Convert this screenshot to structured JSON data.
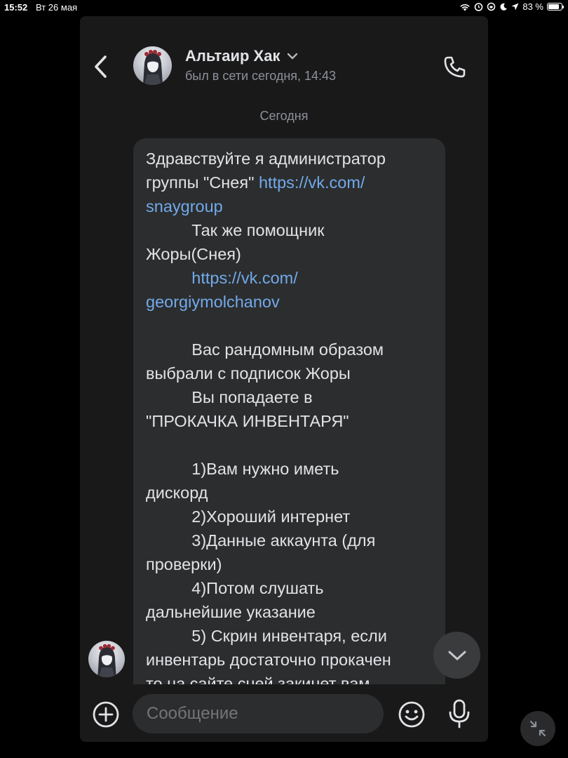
{
  "status_bar": {
    "time": "15:52",
    "date": "Вт 26 мая",
    "battery_percent": "83 %",
    "battery_level": 0.83
  },
  "chat": {
    "contact_name": "Альтаир Хак",
    "contact_status": "был в сети сегодня, 14:43",
    "date_separator": "Сегодня",
    "message_lines": [
      {
        "text": "Здравствуйте я администратор",
        "link": false
      },
      {
        "text": "группы \"Снея\" ",
        "link_text": "https://vk.com/",
        "link": true
      },
      {
        "text": "snaygroup",
        "link": true,
        "full_link": true
      },
      {
        "text": "          Так же помощник",
        "link": false
      },
      {
        "text": "Жоры(Снея)",
        "link": false
      },
      {
        "text": "          https://vk.com/",
        "link": true,
        "full_link": true
      },
      {
        "text": "georgiymolchanov",
        "link": true,
        "full_link": true
      },
      {
        "text": "",
        "link": false
      },
      {
        "text": "          Вас рандомным образом",
        "link": false
      },
      {
        "text": "выбрали с подписок Жоры",
        "link": false
      },
      {
        "text": "          Вы попадаете в",
        "link": false
      },
      {
        "text": "\"ПРОКАЧКА ИНВЕНТАРЯ\"",
        "link": false
      },
      {
        "text": "",
        "link": false
      },
      {
        "text": "          1)Вам нужно иметь",
        "link": false
      },
      {
        "text": "дискорд",
        "link": false
      },
      {
        "text": "          2)Хороший интернет",
        "link": false
      },
      {
        "text": "          3)Данные аккаунта (для",
        "link": false
      },
      {
        "text": "проверки)",
        "link": false
      },
      {
        "text": "          4)Потом слушать",
        "link": false
      },
      {
        "text": "дальнейшие указание",
        "link": false
      },
      {
        "text": "          5) Скрин инвентаря, если",
        "link": false
      },
      {
        "text": "инвентарь достаточно прокачен",
        "link": false
      },
      {
        "text": "то на сайте сней закинет вам",
        "link": false
      }
    ]
  },
  "composer": {
    "placeholder": "Сообщение"
  },
  "icons": {
    "back": "chevron-left-icon",
    "call": "phone-icon",
    "add": "plus-circle-icon",
    "emoji": "smile-icon",
    "mic": "microphone-icon",
    "scroll": "chevron-down-icon",
    "minimize": "minimize-icon"
  },
  "colors": {
    "background": "#19191a",
    "bubble": "#2c2d2e",
    "link": "#71aaeb",
    "secondary_text": "#8d9199"
  }
}
